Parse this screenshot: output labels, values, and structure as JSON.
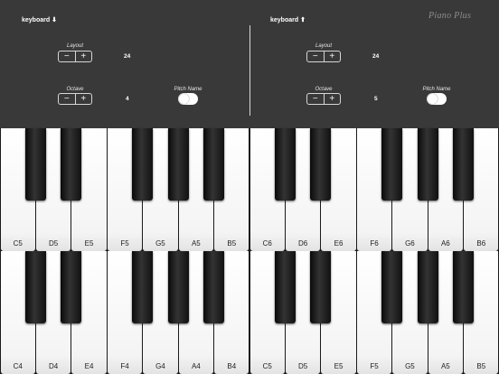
{
  "brand": "Piano Plus",
  "panels": [
    {
      "title": "keyboard ⬇",
      "layout_label": "Layout",
      "layout_value": "24",
      "octave_label": "Octave",
      "octave_value": "4",
      "pitch_name_label": "Pitch Name",
      "minus_symbol": "−",
      "plus_symbol": "+"
    },
    {
      "title": "keyboard ⬆",
      "layout_label": "Layout",
      "layout_value": "24",
      "octave_label": "Octave",
      "octave_value": "5",
      "pitch_name_label": "Pitch Name",
      "minus_symbol": "−",
      "plus_symbol": "+"
    }
  ],
  "keyboards": [
    {
      "notes": [
        "C5",
        "D5",
        "E5",
        "F5",
        "G5",
        "A5",
        "B5",
        "C6",
        "D6",
        "E6",
        "F6",
        "G6",
        "A6",
        "B6"
      ]
    },
    {
      "notes": [
        "C4",
        "D4",
        "E4",
        "F4",
        "G4",
        "A4",
        "B4",
        "C5",
        "D5",
        "E5",
        "F5",
        "G5",
        "A5",
        "B5"
      ]
    }
  ],
  "toggles": [
    {
      "on": true
    },
    {
      "on": true
    }
  ]
}
